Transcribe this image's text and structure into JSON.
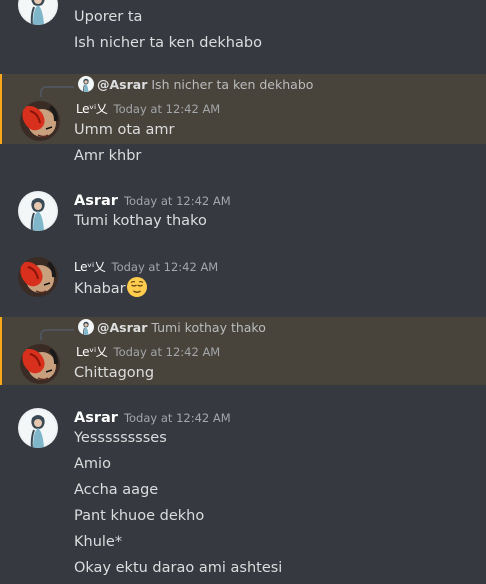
{
  "users": {
    "asrar": "Asrar",
    "levi": "Leᵛⁱ乂"
  },
  "messages": {
    "m1": {
      "lines": [
        "Uporer ta",
        "Ish nicher ta ken dekhabo"
      ]
    },
    "m2": {
      "reply": {
        "mention": "@Asrar",
        "text": "Ish nicher ta ken dekhabo"
      },
      "author": "Leᵛⁱ乂",
      "time": "Today at 12:42 AM",
      "lines": [
        "Umm ota amr",
        "Amr khbr"
      ]
    },
    "m3": {
      "author": "Asrar",
      "time": "Today at 12:42 AM",
      "lines": [
        "Tumi kothay thako"
      ]
    },
    "m4": {
      "author": "Leᵛⁱ乂",
      "time": "Today at 12:42 AM",
      "lines": [
        "Khabar"
      ],
      "emoji": "relieved-face-emoji"
    },
    "m5": {
      "reply": {
        "mention": "@Asrar",
        "text": "Tumi kothay thako"
      },
      "author": "Leᵛⁱ乂",
      "time": "Today at 12:42 AM",
      "lines": [
        "Chittagong"
      ]
    },
    "m6": {
      "author": "Asrar",
      "time": "Today at 12:42 AM",
      "lines": [
        "Yesssssssses",
        "Amio",
        "Accha aage",
        "Pant khuoe dekho",
        "Khule*",
        "Okay ektu darao ami ashtesi"
      ]
    }
  },
  "colors": {
    "background": "#36393f",
    "mention_highlight": "#faa81a",
    "username": "#ffffff",
    "message_text": "#dcddde",
    "timestamp": "#a3a6aa"
  }
}
